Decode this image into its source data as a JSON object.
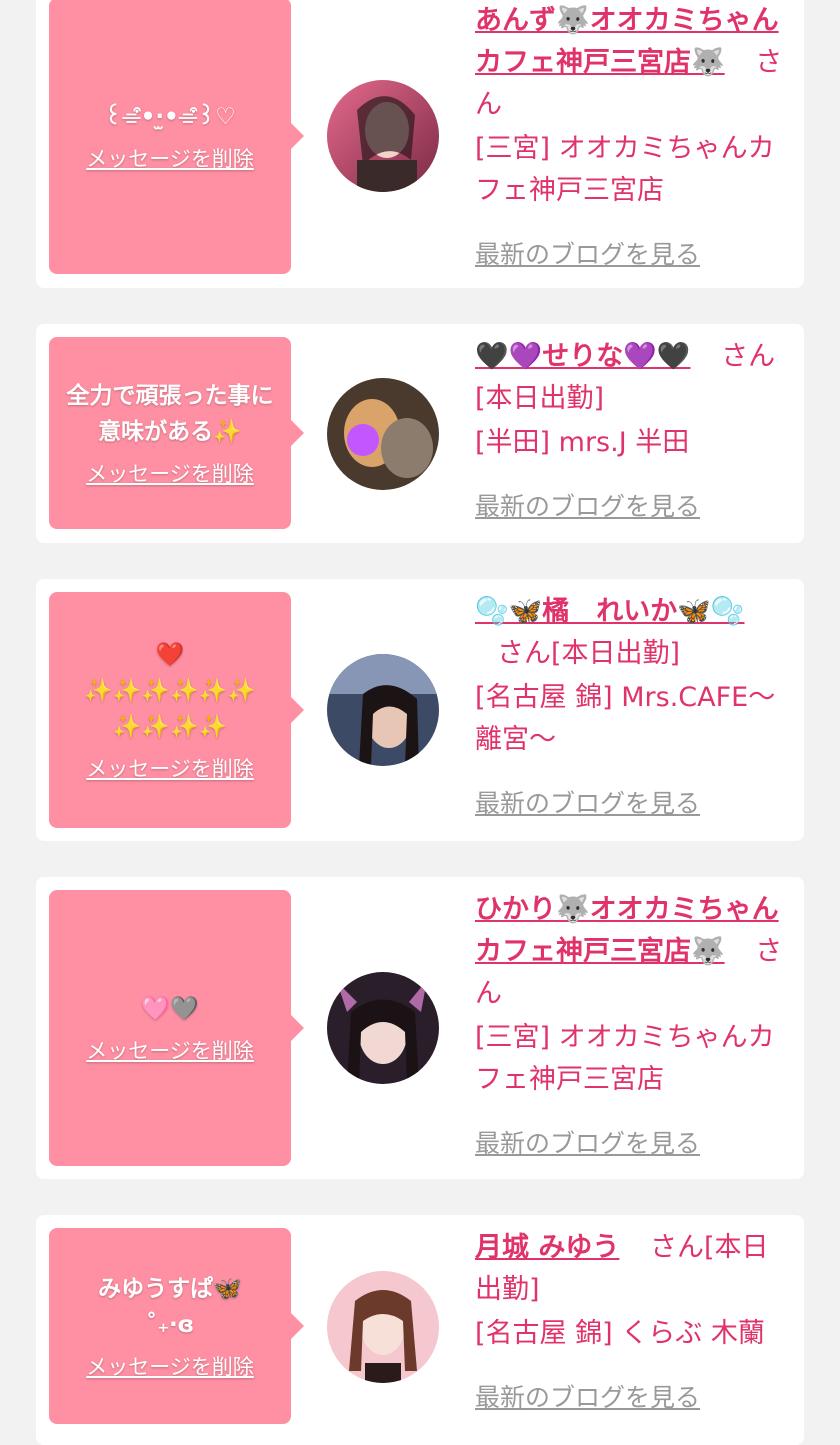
{
  "delete_label": "メッセージを削除",
  "blog_label": "最新のブログを見る",
  "san_suffix": "さん",
  "colors": {
    "bubble": "#ff8fa3",
    "accent": "#e0336a",
    "muted": "#999999",
    "background": "#f2f2f2"
  },
  "entries": [
    {
      "message": "꒰⌯͒•·̫•⌯͒꒱♡",
      "name": "あんず🐺オオカミちゃんカフェ神戸三宮店🐺",
      "suffix": "さん",
      "shop": "[三宮] オオカミちゃんカフェ神戸三宮店"
    },
    {
      "message": "全力で頑張った事に意味がある✨",
      "name": "🖤💜せりな💜🖤",
      "suffix": "さん[本日出勤]",
      "shop": "[半田] mrs.J 半田"
    },
    {
      "message": "❤️\n✨✨✨✨✨✨\n✨✨✨✨",
      "name": "🫧🦋橘　れいか🦋🫧",
      "suffix": "さん[本日出勤]",
      "shop": "[名古屋 錦] Mrs.CAFE〜離宮〜"
    },
    {
      "message": "🩷🩶",
      "name": "ひかり🐺オオカミちゃんカフェ神戸三宮店🐺",
      "suffix": "さん",
      "shop": "[三宮] オオカミちゃんカフェ神戸三宮店"
    },
    {
      "message": "みゆうすぱ🦋\n˚₊‧ɞ",
      "name": "月城 みゆう",
      "suffix": "さん[本日出勤]",
      "shop": "[名古屋 錦] くらぶ 木蘭"
    }
  ]
}
